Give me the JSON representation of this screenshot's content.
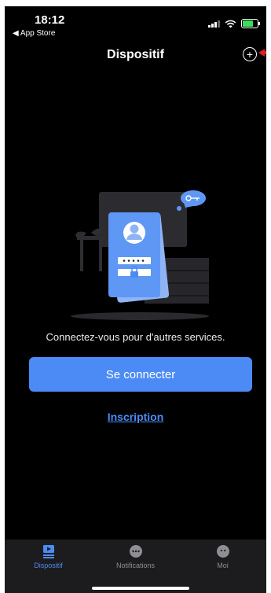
{
  "status_bar": {
    "time": "18:12",
    "back_app": "◀ App Store"
  },
  "nav": {
    "title": "Dispositif",
    "add_icon": "plus-circle-icon"
  },
  "main": {
    "prompt": "Connectez-vous pour d'autres services.",
    "login_button": "Se connecter",
    "signup_link": "Inscription"
  },
  "tabs": [
    {
      "label": "Dispositif",
      "icon": "device-icon",
      "active": true
    },
    {
      "label": "Notifications",
      "icon": "chat-bubble-icon",
      "active": false
    },
    {
      "label": "Moi",
      "icon": "person-icon",
      "active": false
    }
  ],
  "colors": {
    "accent": "#4c8bf5",
    "background": "#000000",
    "tab_bar": "#1c1c1e",
    "inactive": "#8e8e93"
  }
}
